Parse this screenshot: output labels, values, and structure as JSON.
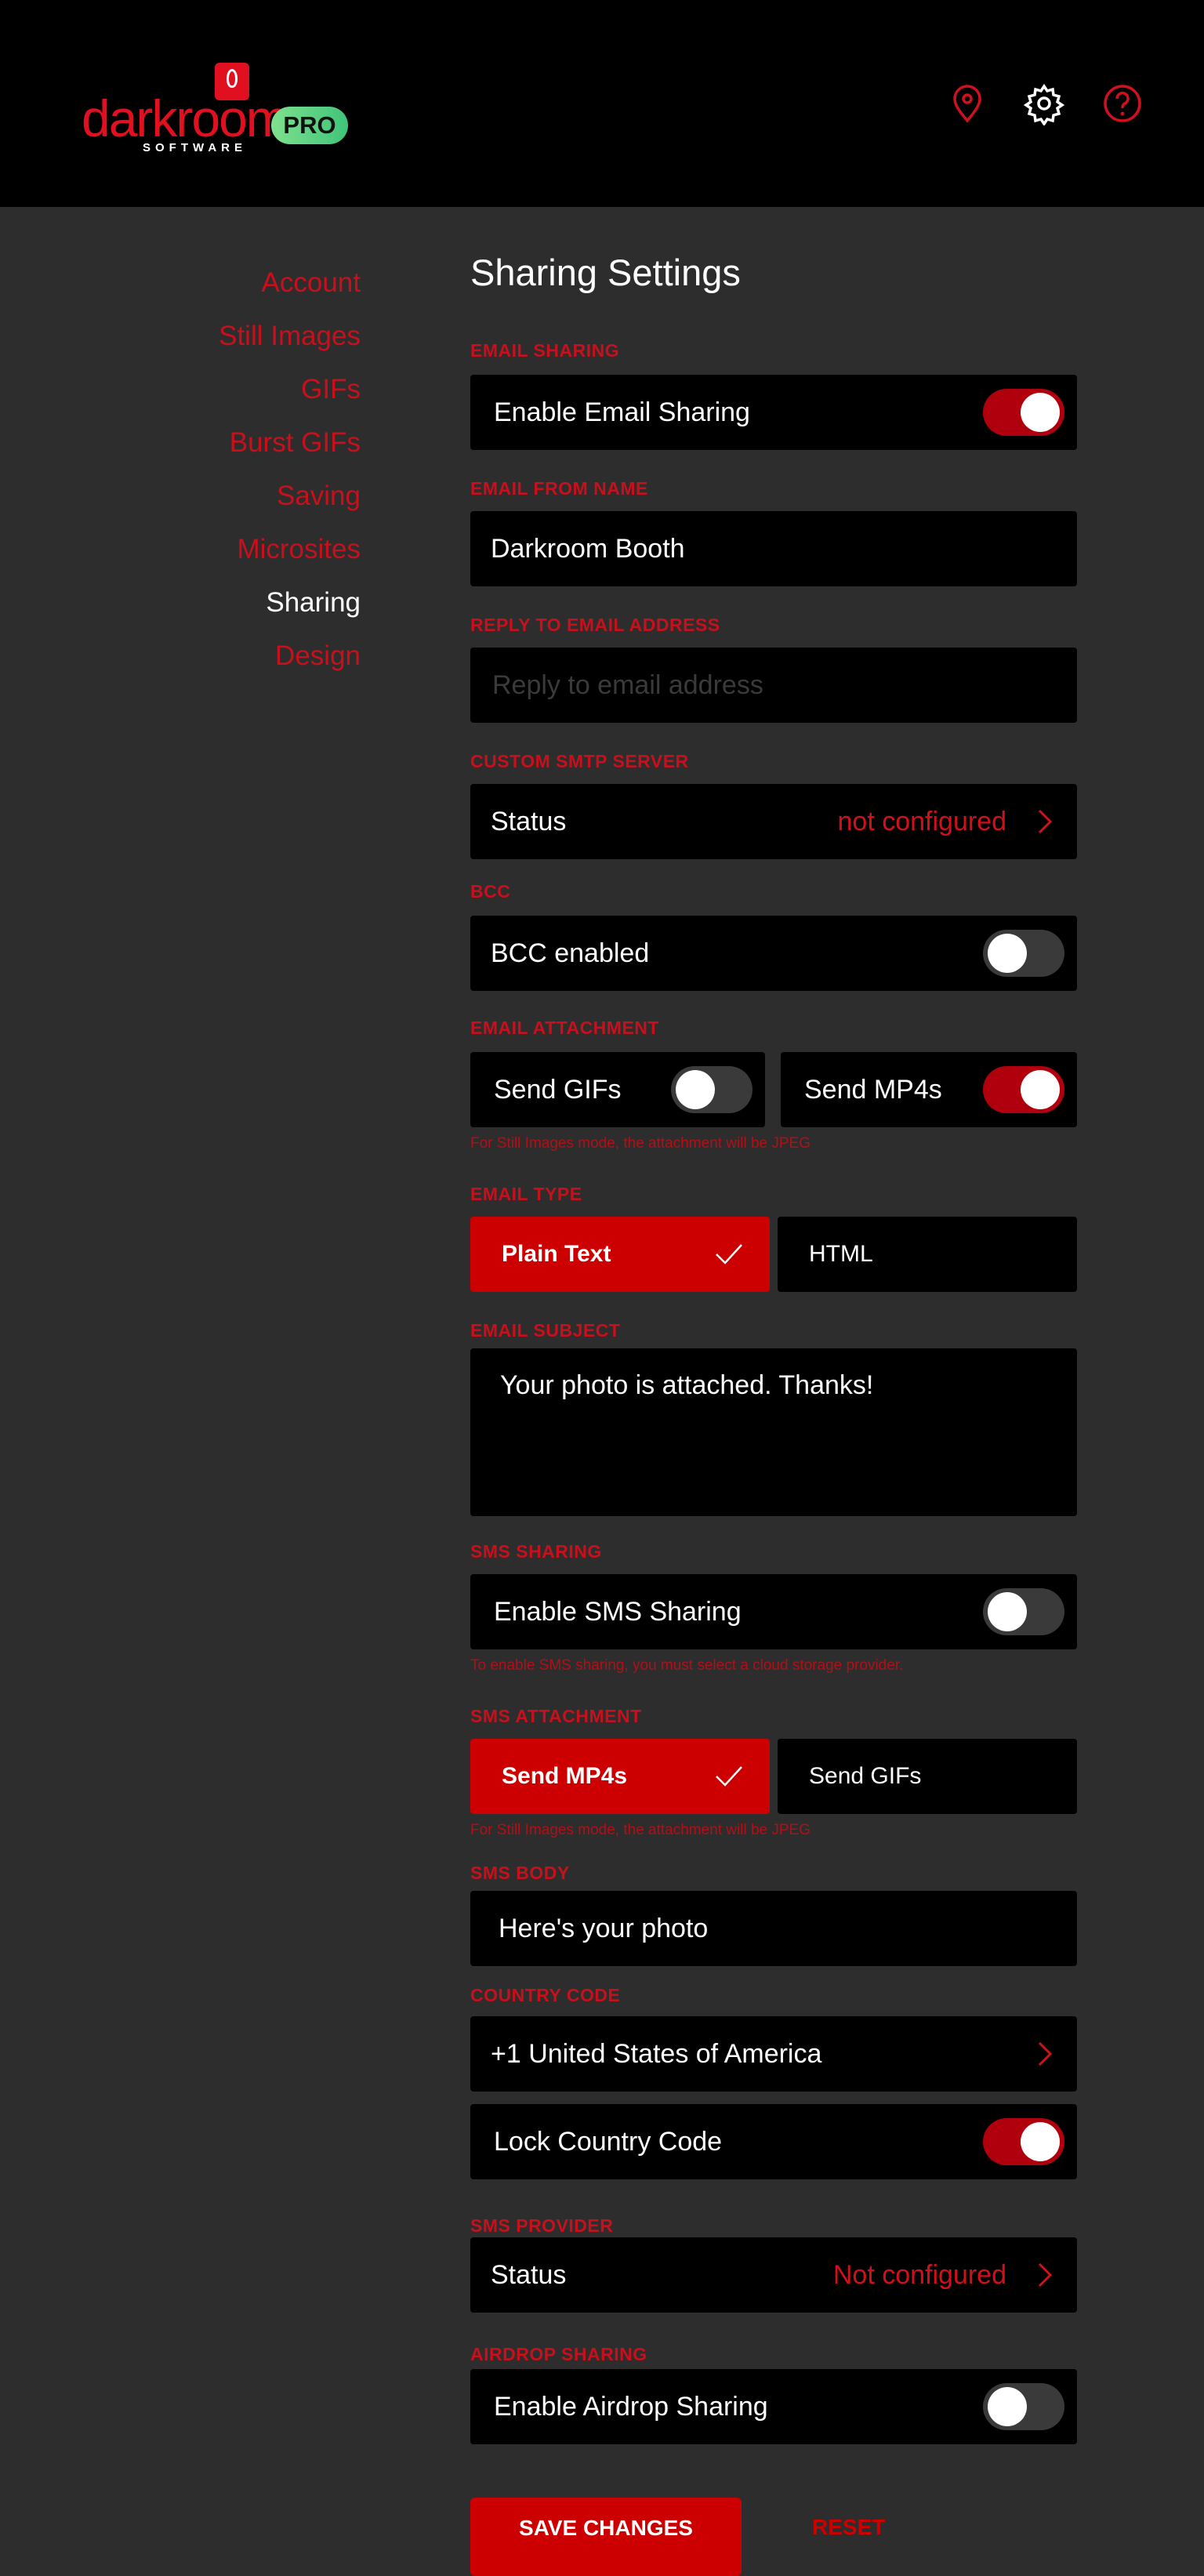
{
  "header": {
    "logo_text": "darkroom",
    "logo_sub": "SOFTWARE",
    "badge": "PRO",
    "icons": [
      "location-pin-icon",
      "gear-icon",
      "help-icon"
    ]
  },
  "sidebar": {
    "items": [
      {
        "label": "Account"
      },
      {
        "label": "Still Images"
      },
      {
        "label": "GIFs"
      },
      {
        "label": "Burst GIFs"
      },
      {
        "label": "Saving"
      },
      {
        "label": "Microsites"
      },
      {
        "label": "Sharing",
        "active": true
      },
      {
        "label": "Design"
      }
    ]
  },
  "main": {
    "title": "Sharing Settings",
    "email_sharing": {
      "label": "EMAIL SHARING",
      "row": "Enable Email Sharing",
      "on": true
    },
    "email_from": {
      "label": "EMAIL FROM NAME",
      "value": "Darkroom Booth"
    },
    "reply_to": {
      "label": "REPLY TO EMAIL ADDRESS",
      "placeholder": "Reply to email address"
    },
    "smtp": {
      "label": "CUSTOM SMTP SERVER",
      "row": "Status",
      "value": "not configured"
    },
    "bcc": {
      "label": "BCC",
      "row": "BCC enabled",
      "on": false
    },
    "email_attachment": {
      "label": "EMAIL ATTACHMENT",
      "gifs": "Send GIFs",
      "gifs_on": false,
      "mp4s": "Send MP4s",
      "mp4s_on": true,
      "hint": "For Still Images mode, the attachment will be JPEG"
    },
    "email_type": {
      "label": "EMAIL TYPE",
      "options": [
        "Plain Text",
        "HTML"
      ],
      "selected": "Plain Text"
    },
    "email_subject": {
      "label": "EMAIL SUBJECT",
      "value": "Your photo is attached. Thanks!"
    },
    "sms_sharing": {
      "label": "SMS SHARING",
      "row": "Enable SMS Sharing",
      "on": false,
      "hint": "To enable SMS sharing, you must select a cloud storage provider."
    },
    "sms_attachment": {
      "label": "SMS ATTACHMENT",
      "options": [
        "Send MP4s",
        "Send GIFs"
      ],
      "selected": "Send MP4s",
      "hint": "For Still Images mode, the attachment will be JPEG"
    },
    "sms_body": {
      "label": "SMS BODY",
      "value": "Here's your photo"
    },
    "country_code": {
      "label": "COUNTRY CODE",
      "value": "+1 United States of America",
      "lock_label": "Lock Country Code",
      "lock_on": true
    },
    "sms_provider": {
      "label": "SMS PROVIDER",
      "row": "Status",
      "value": "Not configured"
    },
    "airdrop": {
      "label": "AIRDROP SHARING",
      "row": "Enable Airdrop Sharing",
      "on": false
    },
    "buttons": {
      "save": "SAVE CHANGES",
      "reset": "RESET"
    }
  },
  "colors": {
    "accent": "#cc0000",
    "bg": "#2d2d2d",
    "header": "#000000",
    "badge": "#4bd37b"
  }
}
